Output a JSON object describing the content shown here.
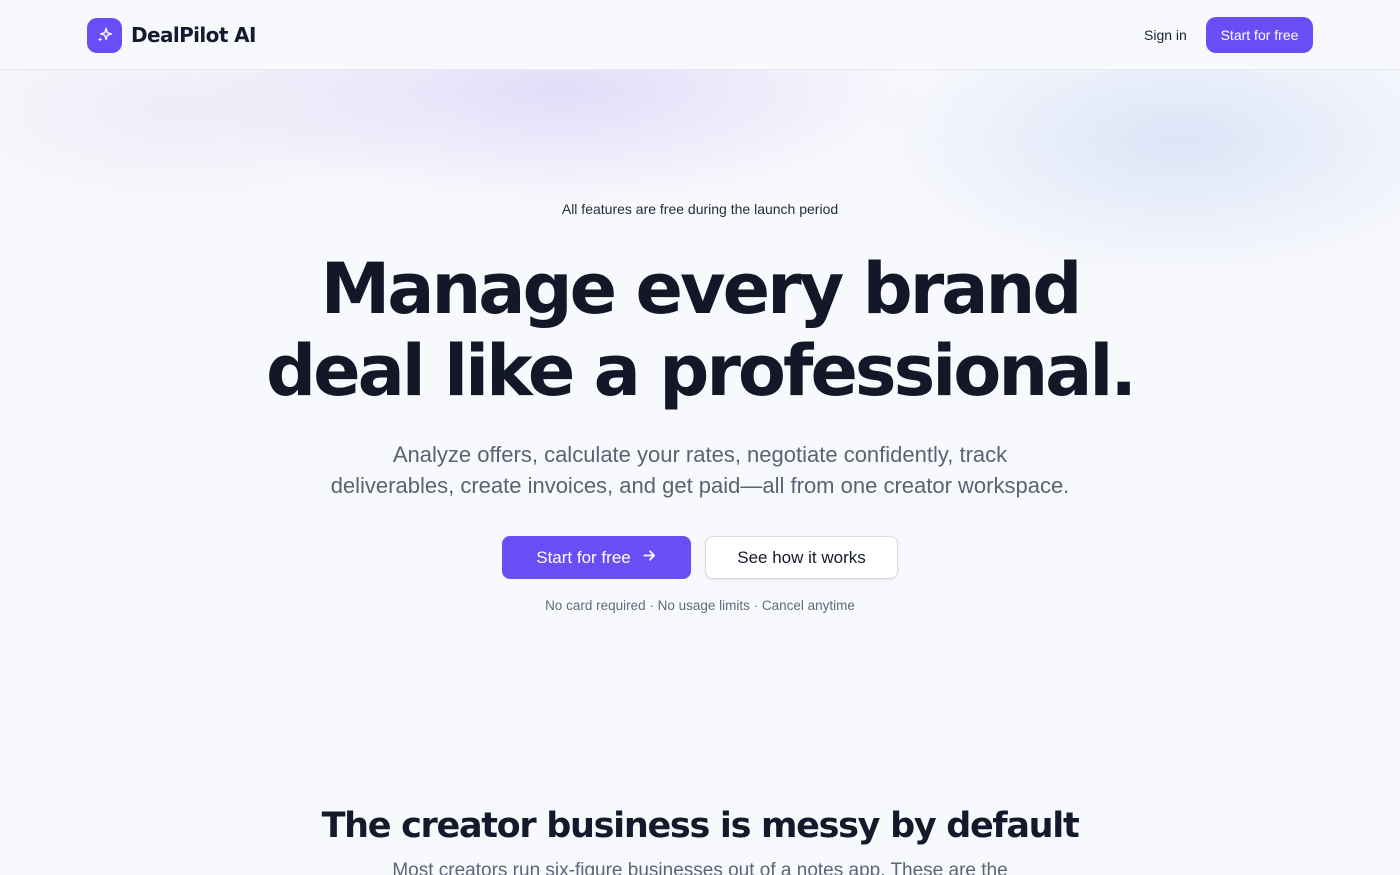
{
  "brand": {
    "name": "DealPilot AI",
    "accent": "#6a4ef5"
  },
  "nav": {
    "signin_label": "Sign in",
    "cta_label": "Start for free"
  },
  "hero": {
    "badge": "All features are free during the launch period",
    "headline_line1": "Manage every brand",
    "headline_line2": "deal like a professional.",
    "subtext": "Analyze offers, calculate your rates, negotiate confidently, track deliverables, create invoices, and get paid—all from one creator workspace.",
    "primary_cta_label": "Start for free",
    "primary_cta_icon": "arrow-right-icon",
    "secondary_cta_label": "See how it works",
    "reassurance": "No card required · No usage limits · Cancel anytime"
  },
  "problem_section": {
    "title": "The creator business is messy by default",
    "subtitle": "Most creators run six-figure businesses out of a notes app. These are the"
  }
}
